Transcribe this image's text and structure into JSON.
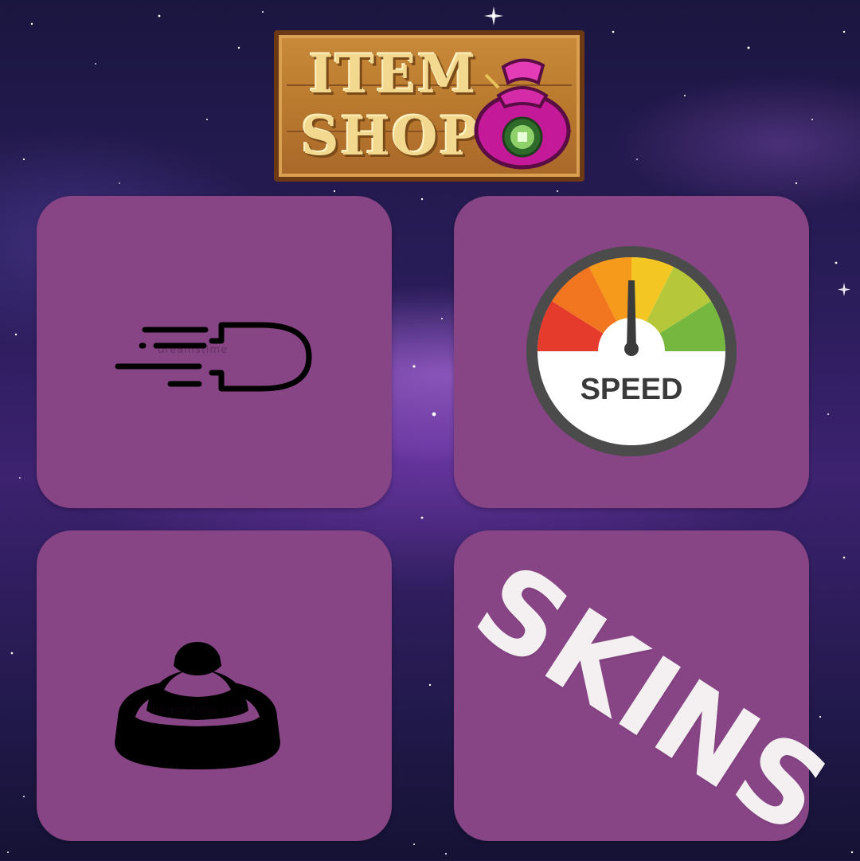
{
  "logo": {
    "line1": "ITEM",
    "line2": "SHOP"
  },
  "tiles": [
    {
      "name": "bullet-tile",
      "icon": "flying-bullet-icon"
    },
    {
      "name": "speed-tile",
      "icon": "speedometer-icon",
      "label": "SPEED"
    },
    {
      "name": "button-tile",
      "icon": "dome-button-icon"
    },
    {
      "name": "skins-tile",
      "label": "SKINS"
    }
  ],
  "colors": {
    "tile": "#874585",
    "logo_text": "#f3d98f",
    "logo_wood": "#b97a2e",
    "skins_text": "#f4f0f2",
    "gauge_red": "#e53b2c",
    "gauge_orange": "#f59a1b",
    "gauge_yellow": "#f3c623",
    "gauge_green": "#76b83f"
  },
  "watermarks": [
    "dreamstime",
    "dreamstime.com"
  ]
}
